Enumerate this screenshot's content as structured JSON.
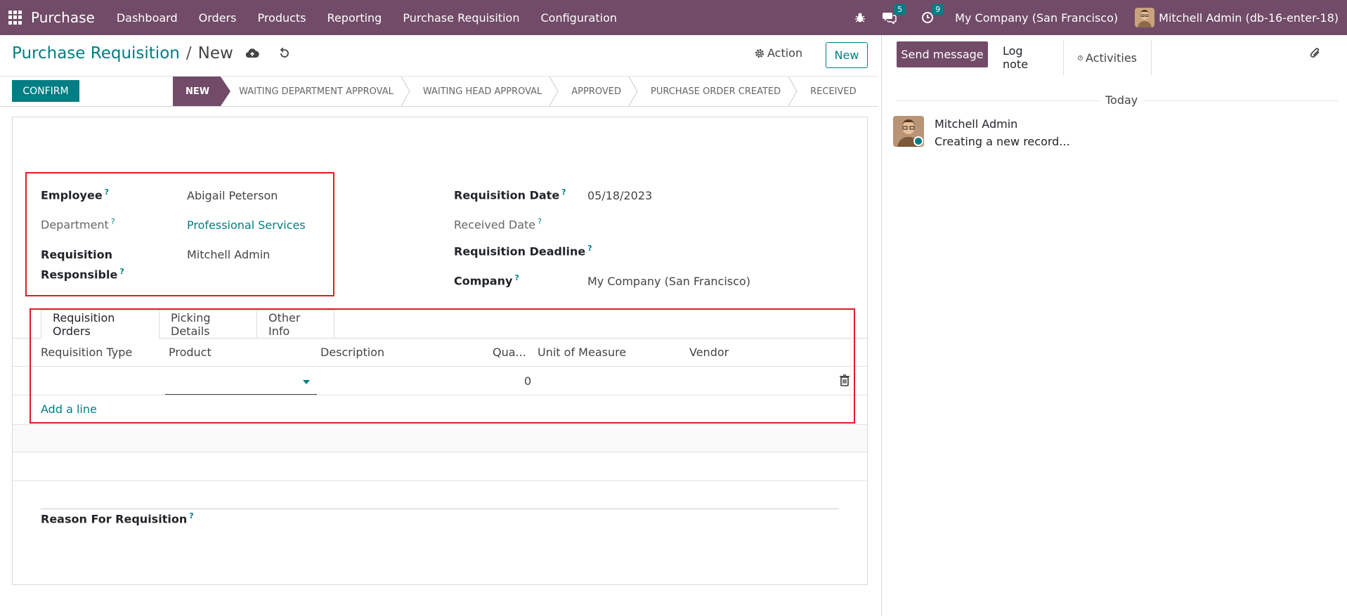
{
  "topnav": {
    "brand": "Purchase",
    "menu": [
      "Dashboard",
      "Orders",
      "Products",
      "Reporting",
      "Purchase Requisition",
      "Configuration"
    ],
    "messages_count": "5",
    "activities_count": "9",
    "company": "My Company (San Francisco)",
    "user": "Mitchell Admin (db-16-enter-18)",
    "bar_color": "#714B67"
  },
  "control": {
    "breadcrumb_parent": "Purchase Requisition",
    "breadcrumb_sep": "/",
    "breadcrumb_current": "New",
    "action_label": "Action",
    "new_label": "New"
  },
  "statusbar": {
    "confirm_label": "CONFIRM",
    "stages": [
      "NEW",
      "WAITING DEPARTMENT APPROVAL",
      "WAITING HEAD APPROVAL",
      "APPROVED",
      "PURCHASE ORDER CREATED",
      "RECEIVED"
    ],
    "active_stage": "NEW"
  },
  "form": {
    "help_mark": "?",
    "employee_label": "Employee",
    "employee_value": "Abigail Peterson",
    "department_label": "Department",
    "department_value": "Professional Services",
    "responsible_label_1": "Requisition",
    "responsible_label_2": "Responsible",
    "responsible_value": "Mitchell Admin",
    "req_date_label": "Requisition Date",
    "req_date_value": "05/18/2023",
    "received_date_label": "Received Date",
    "deadline_label": "Requisition Deadline",
    "company_label": "Company",
    "company_value": "My Company (San Francisco)",
    "reason_label": "Reason For Requisition"
  },
  "tabs": [
    "Requisition Orders",
    "Picking Details",
    "Other Info"
  ],
  "table": {
    "columns": [
      "Requisition Type",
      "Product",
      "Description",
      "Qua...",
      "Unit of Measure",
      "Vendor"
    ],
    "row": {
      "quantity": "0"
    },
    "add_line": "Add a line"
  },
  "chatter": {
    "send_message": "Send message",
    "log_note": "Log note",
    "activities": "Activities",
    "date_separator": "Today",
    "author": "Mitchell Admin",
    "body": "Creating a new record..."
  },
  "colors": {
    "primary": "#714B67",
    "accent": "#017e84",
    "highlight": "#e01b24"
  }
}
